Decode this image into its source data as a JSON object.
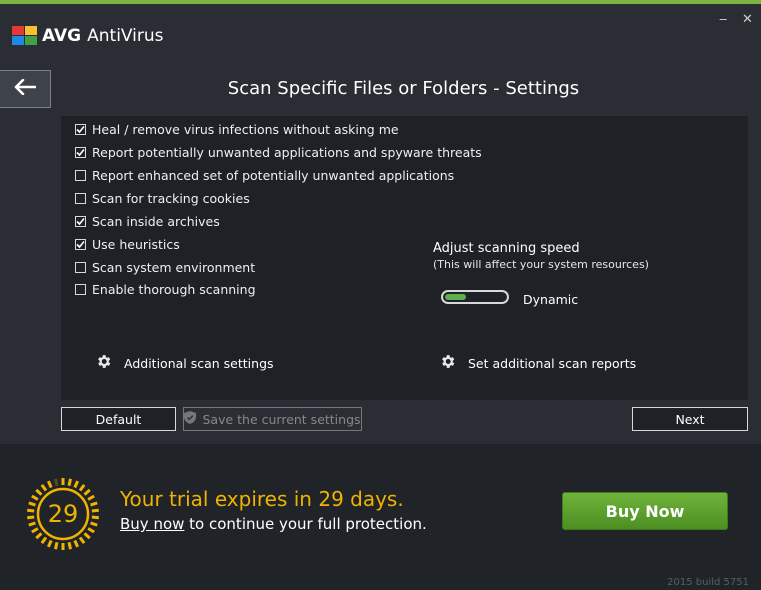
{
  "app": {
    "brand": "AVG",
    "product": "AntiVirus"
  },
  "window": {
    "minimize": "‒",
    "close": "✕"
  },
  "page": {
    "title": "Scan Specific Files or Folders - Settings"
  },
  "options": [
    {
      "label": "Heal / remove virus infections without asking me",
      "checked": true
    },
    {
      "label": "Report potentially unwanted applications and spyware threats",
      "checked": true
    },
    {
      "label": "Report enhanced set of potentially unwanted applications",
      "checked": false
    },
    {
      "label": "Scan for tracking cookies",
      "checked": false
    },
    {
      "label": "Scan inside archives",
      "checked": true
    },
    {
      "label": "Use heuristics",
      "checked": true
    },
    {
      "label": "Scan system environment",
      "checked": false
    },
    {
      "label": "Enable thorough scanning",
      "checked": false
    }
  ],
  "speed": {
    "title": "Adjust scanning speed",
    "subtitle": "(This will affect your system resources)",
    "value_label": "Dynamic",
    "level": 0.35
  },
  "links": {
    "additional_scan_settings": "Additional scan settings",
    "additional_scan_reports": "Set additional scan reports"
  },
  "buttons": {
    "default": "Default",
    "save": "Save the current settings",
    "next": "Next"
  },
  "trial": {
    "days": "29",
    "message": "Your trial expires in 29 days.",
    "link": "Buy now",
    "rest": " to continue your full protection."
  },
  "buy": {
    "label": "Buy Now"
  },
  "build": "2015  build 5751",
  "colors": {
    "accent_green": "#7cb342",
    "trial_orange": "#f0b400"
  }
}
